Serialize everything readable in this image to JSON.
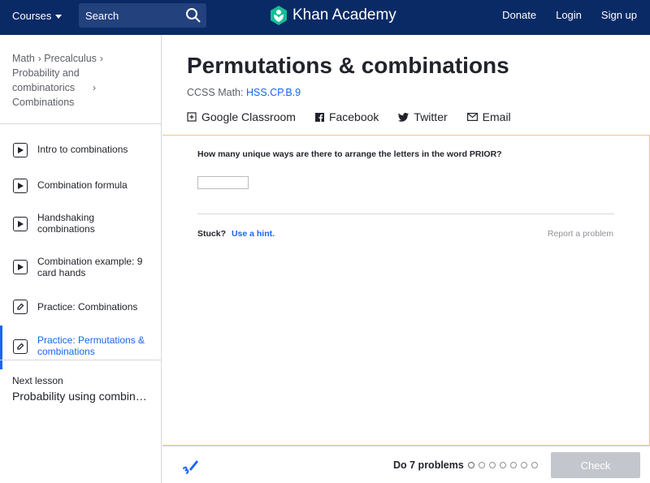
{
  "header": {
    "courses_label": "Courses",
    "search_placeholder": "Search",
    "brand": "Khan Academy",
    "links": [
      "Donate",
      "Login",
      "Sign up"
    ]
  },
  "breadcrumb": {
    "items": [
      "Math",
      "Precalculus",
      "Probability and combinatorics",
      "Combinations"
    ]
  },
  "lessons": [
    {
      "label": "Intro to combinations",
      "type": "video",
      "active": false
    },
    {
      "label": "Combination formula",
      "type": "video",
      "active": false
    },
    {
      "label": "Handshaking combinations",
      "type": "video",
      "active": false
    },
    {
      "label": "Combination example: 9 card hands",
      "type": "video",
      "active": false
    },
    {
      "label": "Practice: Combinations",
      "type": "practice",
      "active": false
    },
    {
      "label": "Practice: Permutations & combinations",
      "type": "practice",
      "active": true
    }
  ],
  "next_lesson": {
    "label": "Next lesson",
    "title": "Probability using combinat…"
  },
  "main": {
    "title": "Permutations & combinations",
    "ccss_label": "CCSS Math:",
    "ccss_code": "HSS.CP.B.9",
    "share": {
      "google_classroom": "Google Classroom",
      "facebook": "Facebook",
      "twitter": "Twitter",
      "email": "Email"
    }
  },
  "exercise": {
    "question": "How many unique ways are there to arrange the letters in the word PRIOR?",
    "answer_value": "",
    "stuck_label": "Stuck?",
    "hint_link": "Use a hint.",
    "report_link": "Report a problem"
  },
  "footer": {
    "do_problems": "Do 7 problems",
    "problem_count": 7,
    "check_label": "Check"
  },
  "colors": {
    "header_bg": "#0a2a66",
    "accent": "#1865f2",
    "exercise_border": "#f0c38a",
    "check_disabled": "#c3c6cc",
    "logo_green": "#14bf96"
  }
}
